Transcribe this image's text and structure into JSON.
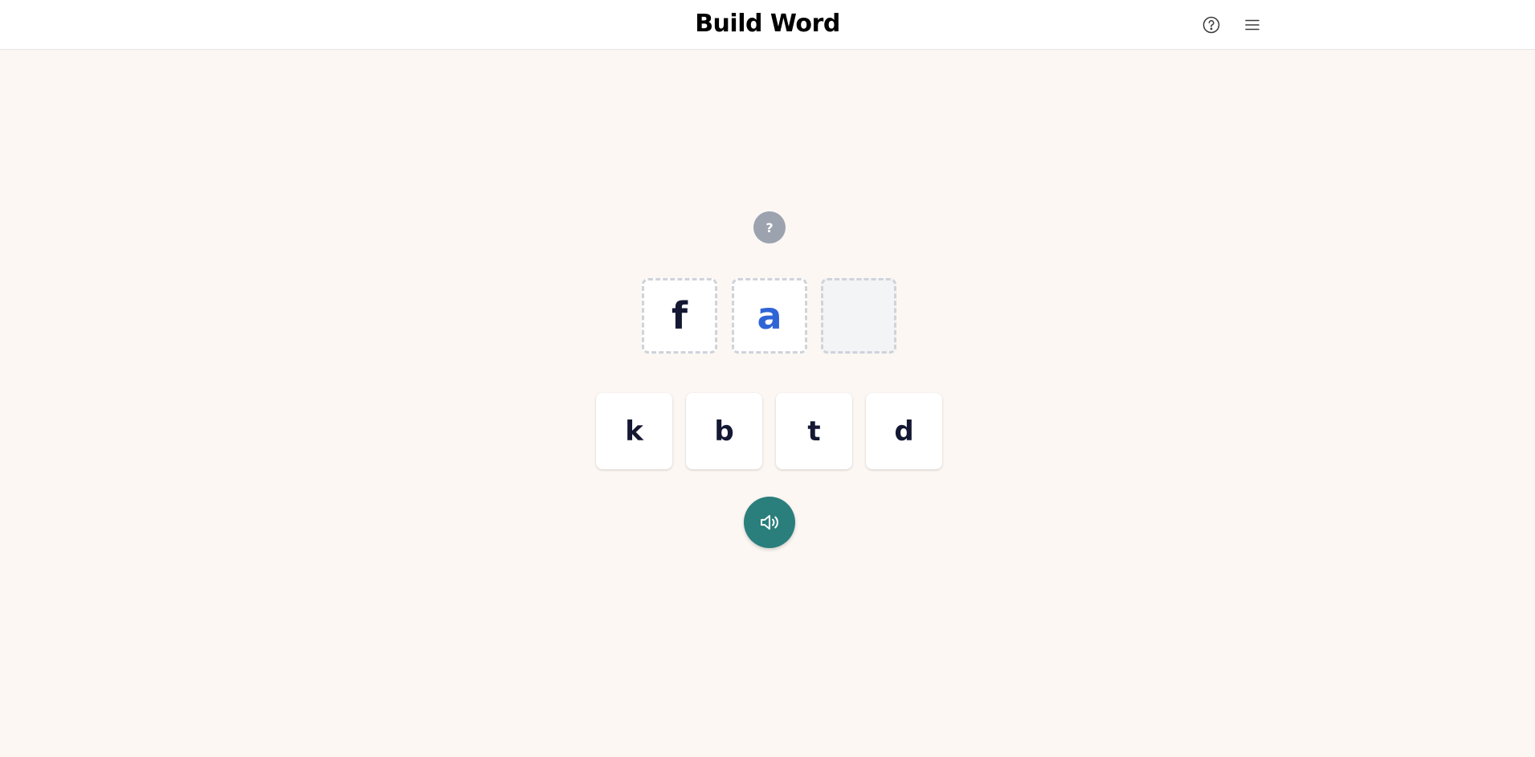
{
  "header": {
    "title": "Build Word",
    "help_icon": "help-circle-icon",
    "menu_icon": "hamburger-menu-icon"
  },
  "hint": {
    "label": "?"
  },
  "word_slots": [
    {
      "letter": "f",
      "state": "filled"
    },
    {
      "letter": "a",
      "state": "filled",
      "vowel": true
    },
    {
      "letter": "",
      "state": "empty"
    }
  ],
  "letter_tiles": [
    {
      "letter": "k"
    },
    {
      "letter": "b"
    },
    {
      "letter": "t"
    },
    {
      "letter": "d"
    }
  ],
  "audio": {
    "icon": "speaker-icon"
  },
  "colors": {
    "background": "#fcf7f3",
    "header_bg": "#ffffff",
    "hint_badge": "#9ca3af",
    "consonant_text": "#141833",
    "vowel_text": "#2f64d6",
    "slot_border": "#cfd3da",
    "empty_slot_bg": "#f3f4f6",
    "sound_button": "#2a7f7d"
  }
}
